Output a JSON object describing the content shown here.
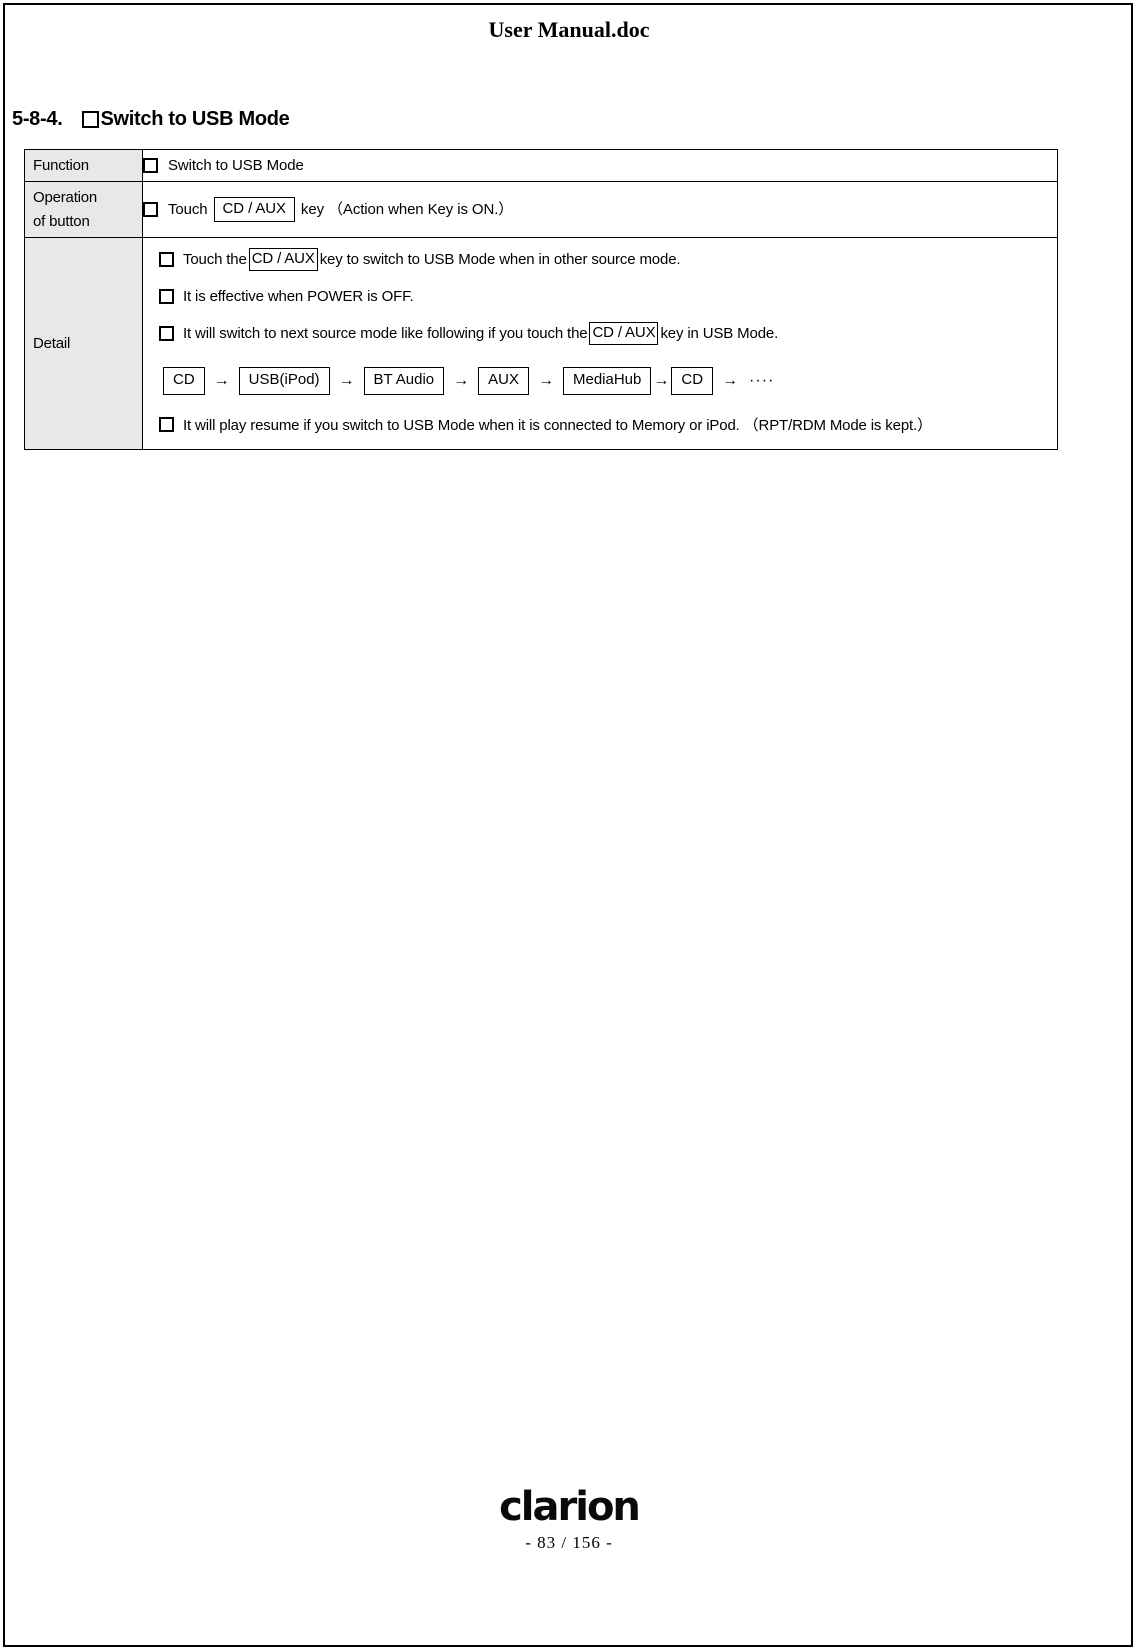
{
  "document": {
    "header_title": "User Manual.doc"
  },
  "section": {
    "number": "5-8-4.",
    "checkbox_icon": "empty-checkbox",
    "title": "Switch to USB Mode"
  },
  "table": {
    "rows": {
      "function": {
        "label": "Function",
        "text": "Switch to USB Mode"
      },
      "operation": {
        "label_line1": "Operation",
        "label_line2": "of button",
        "text_before": "Touch",
        "key": "CD / AUX",
        "text_after": "key （Action when Key is ON.）"
      },
      "detail": {
        "label": "Detail",
        "lines": [
          {
            "before": "Touch the",
            "key": "CD / AUX",
            "after": "key to switch to USB Mode when in other source mode."
          },
          {
            "before": "It is effective when POWER is OFF.",
            "key": "",
            "after": ""
          },
          {
            "before": "It will switch to next source mode like following if you touch the",
            "key": "CD / AUX",
            "after": "key in USB Mode."
          }
        ],
        "flow": {
          "steps": [
            "CD",
            "USB(iPod)",
            "BT Audio",
            "AUX",
            "MediaHub",
            "CD"
          ],
          "arrow": "→",
          "trailing": "····"
        },
        "last_line": "It will play resume if you switch to USB Mode when it is connected to Memory or iPod. （RPT/RDM Mode is kept.）"
      }
    }
  },
  "footer": {
    "brand": "clarion",
    "page_number": "- 83 / 156 -"
  }
}
